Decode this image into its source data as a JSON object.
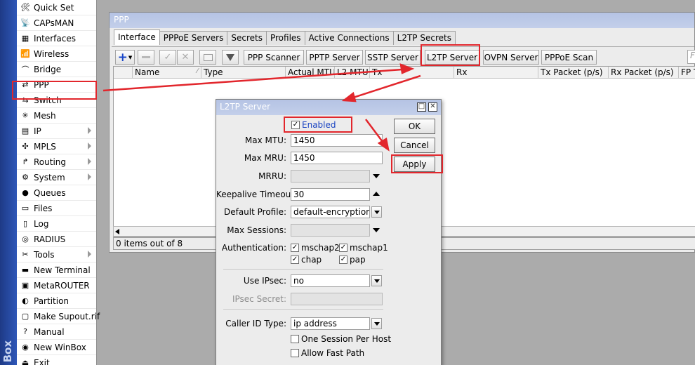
{
  "sidebar": {
    "brand": "Box",
    "items": [
      {
        "label": "Quick Set",
        "icon": "quick-set-icon",
        "arrow": false
      },
      {
        "label": "CAPsMAN",
        "icon": "capsman-icon",
        "arrow": false
      },
      {
        "label": "Interfaces",
        "icon": "interfaces-icon",
        "arrow": false
      },
      {
        "label": "Wireless",
        "icon": "wireless-icon",
        "arrow": false
      },
      {
        "label": "Bridge",
        "icon": "bridge-icon",
        "arrow": false
      },
      {
        "label": "PPP",
        "icon": "ppp-icon",
        "arrow": false
      },
      {
        "label": "Switch",
        "icon": "switch-icon",
        "arrow": false
      },
      {
        "label": "Mesh",
        "icon": "mesh-icon",
        "arrow": false
      },
      {
        "label": "IP",
        "icon": "ip-icon",
        "arrow": true
      },
      {
        "label": "MPLS",
        "icon": "mpls-icon",
        "arrow": true
      },
      {
        "label": "Routing",
        "icon": "routing-icon",
        "arrow": true
      },
      {
        "label": "System",
        "icon": "system-gear-icon",
        "arrow": true
      },
      {
        "label": "Queues",
        "icon": "queues-icon",
        "arrow": false
      },
      {
        "label": "Files",
        "icon": "files-folder-icon",
        "arrow": false
      },
      {
        "label": "Log",
        "icon": "log-icon",
        "arrow": false
      },
      {
        "label": "RADIUS",
        "icon": "radius-icon",
        "arrow": false
      },
      {
        "label": "Tools",
        "icon": "tools-icon",
        "arrow": true
      },
      {
        "label": "New Terminal",
        "icon": "terminal-icon",
        "arrow": false
      },
      {
        "label": "MetaROUTER",
        "icon": "metarouter-icon",
        "arrow": false
      },
      {
        "label": "Partition",
        "icon": "partition-icon",
        "arrow": false
      },
      {
        "label": "Make Supout.rif",
        "icon": "supout-icon",
        "arrow": false
      },
      {
        "label": "Manual",
        "icon": "manual-icon",
        "arrow": false
      },
      {
        "label": "New WinBox",
        "icon": "winbox-icon",
        "arrow": false
      },
      {
        "label": "Exit",
        "icon": "exit-icon",
        "arrow": false
      }
    ]
  },
  "ppp_window": {
    "title": "PPP",
    "tabs": [
      "Interface",
      "PPPoE Servers",
      "Secrets",
      "Profiles",
      "Active Connections",
      "L2TP Secrets"
    ],
    "active_tab": "Interface",
    "toolbar": {
      "icons": [
        "add-icon",
        "remove-icon",
        "enable-check-icon",
        "disable-x-icon",
        "comment-icon",
        "filter-icon"
      ],
      "buttons": [
        "PPP Scanner",
        "PPTP Server",
        "SSTP Server",
        "L2TP Server",
        "OVPN Server",
        "PPPoE Scan"
      ],
      "find_placeholder": "Fi"
    },
    "columns": [
      "",
      "Name",
      "Type",
      "Actual MTU",
      "L2 MTU",
      "Tx",
      "Rx",
      "Tx Packet (p/s)",
      "Rx Packet (p/s)",
      "FP T"
    ],
    "status": "0 items out of 8"
  },
  "l2tp_dialog": {
    "title": "L2TP Server",
    "enabled_label": "Enabled",
    "enabled": true,
    "ok_label": "OK",
    "cancel_label": "Cancel",
    "apply_label": "Apply",
    "fields": {
      "max_mtu": {
        "label": "Max MTU:",
        "value": "1450"
      },
      "max_mru": {
        "label": "Max MRU:",
        "value": "1450"
      },
      "mrru": {
        "label": "MRRU:",
        "value": ""
      },
      "keepalive": {
        "label": "Keepalive Timeout:",
        "value": "30"
      },
      "default_profile": {
        "label": "Default Profile:",
        "value": "default-encryption"
      },
      "max_sessions": {
        "label": "Max Sessions:",
        "value": ""
      },
      "use_ipsec": {
        "label": "Use IPsec:",
        "value": "no"
      },
      "ipsec_secret": {
        "label": "IPsec Secret:",
        "value": ""
      },
      "caller_id": {
        "label": "Caller ID Type:",
        "value": "ip address"
      }
    },
    "auth": {
      "label": "Authentication:",
      "options": [
        {
          "label": "mschap2",
          "checked": true
        },
        {
          "label": "mschap1",
          "checked": true
        },
        {
          "label": "chap",
          "checked": true
        },
        {
          "label": "pap",
          "checked": true
        }
      ]
    },
    "one_session_label": "One Session Per Host",
    "one_session": false,
    "allow_fast_path_label": "Allow Fast Path",
    "allow_fast_path": false
  },
  "colors": {
    "annotation": "#e2262c",
    "title_bar": "#bac6e6",
    "sidebar_strip": "#2a4ea8"
  }
}
